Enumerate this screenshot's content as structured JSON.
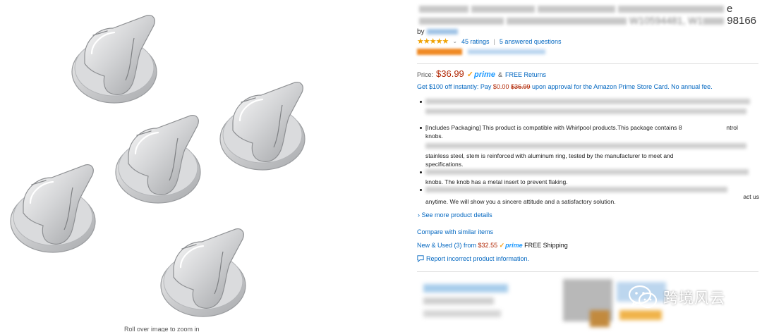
{
  "gallery": {
    "zoom_hint": "Roll over image to zoom in"
  },
  "product": {
    "title_line1_tail": "e",
    "title_line2_tail": "98166",
    "title_line2_mid": "W10594481, W1",
    "byline_prefix": "by",
    "rating_stars": "★★★★★",
    "ratings_text": "45 ratings",
    "separator": "|",
    "answered_text": "5 answered questions"
  },
  "pricing": {
    "price_label": "Price:",
    "price": "$36.99",
    "prime_label": "prime",
    "and": "&",
    "free_returns": "FREE Returns",
    "promo_prefix": "Get $100 off instantly: Pay",
    "promo_pay": "$0.00",
    "promo_strike": "$36.99",
    "promo_suffix": "upon approval for the Amazon Prime Store Card. No annual fee."
  },
  "bullets": {
    "b2_line1": "[Includes Packaging] This product is compatible with Whirlpool products.This package contains 8",
    "b2_line1_tail": "ntrol",
    "b2_line2": "knobs.",
    "b3_line2": "stainless steel, stem is reinforced with aluminum ring, tested by the manufacturer to meet and",
    "b3_line3": "specifications.",
    "b4_line2": "knobs. The knob has a metal insert to prevent flaking.",
    "b5_tail": "act us",
    "b5_line2": "anytime. We will show you a sincere attitude and a satisfactory solution."
  },
  "links": {
    "see_more": "See more product details",
    "compare": "Compare with similar items",
    "new_used_prefix": "New & Used (3) from",
    "new_used_price": "$32.55",
    "new_used_prime": "prime",
    "new_used_ship": "FREE Shipping",
    "report": "Report incorrect product information."
  },
  "watermark": {
    "text": "跨境风云"
  },
  "colors": {
    "link": "#0066c0",
    "price": "#b12704",
    "prime": "#1a98ff",
    "star": "#f0a202"
  }
}
